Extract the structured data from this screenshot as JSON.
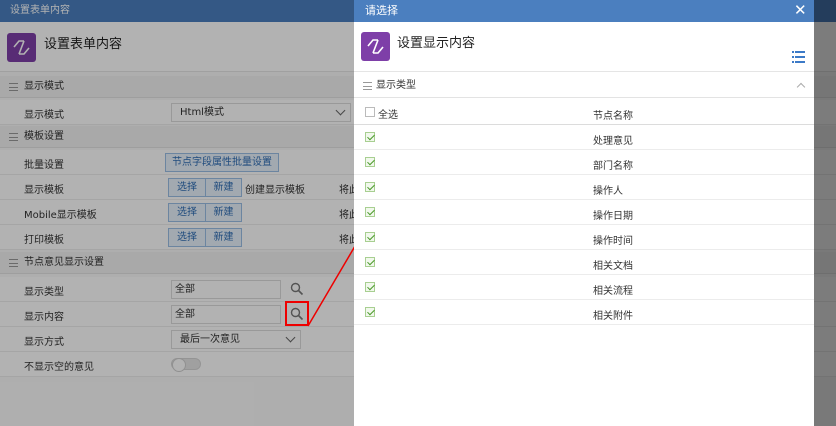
{
  "background_window": {
    "title": "设置表单内容",
    "header_title": "设置表单内容",
    "sections": {
      "display_mode": "显示模式",
      "template_settings": "模板设置",
      "opinion_settings": "节点意见显示设置"
    },
    "rows": {
      "display_mode_label": "显示模式",
      "display_mode_value": "Html模式",
      "batch_label": "批量设置",
      "batch_button": "节点字段属性批量设置",
      "display_template_label": "显示模板",
      "mobile_template_label": "Mobile显示模板",
      "print_template_label": "打印模板",
      "select_button": "选择",
      "new_button": "新建",
      "create_display_template": "创建显示模板",
      "truncated_text": "将此",
      "display_type_label": "显示类型",
      "display_type_value": "全部",
      "display_content_label": "显示内容",
      "display_content_value": "全部",
      "display_method_label": "显示方式",
      "display_method_value": "最后一次意见",
      "hide_empty_label": "不显示空的意见"
    }
  },
  "dialog": {
    "title": "请选择",
    "header_title": "设置显示内容",
    "section_title": "显示类型",
    "select_all_label": "全选",
    "column_name": "节点名称",
    "items": [
      {
        "name": "处理意见",
        "checked": true
      },
      {
        "name": "部门名称",
        "checked": true
      },
      {
        "name": "操作人",
        "checked": true
      },
      {
        "name": "操作日期",
        "checked": true
      },
      {
        "name": "操作时间",
        "checked": true
      },
      {
        "name": "相关文档",
        "checked": true
      },
      {
        "name": "相关流程",
        "checked": true
      },
      {
        "name": "相关附件",
        "checked": true
      }
    ]
  },
  "colors": {
    "titlebar": "#4b7fbf",
    "app_icon": "#7e3fa8",
    "highlight": "#e00000"
  }
}
